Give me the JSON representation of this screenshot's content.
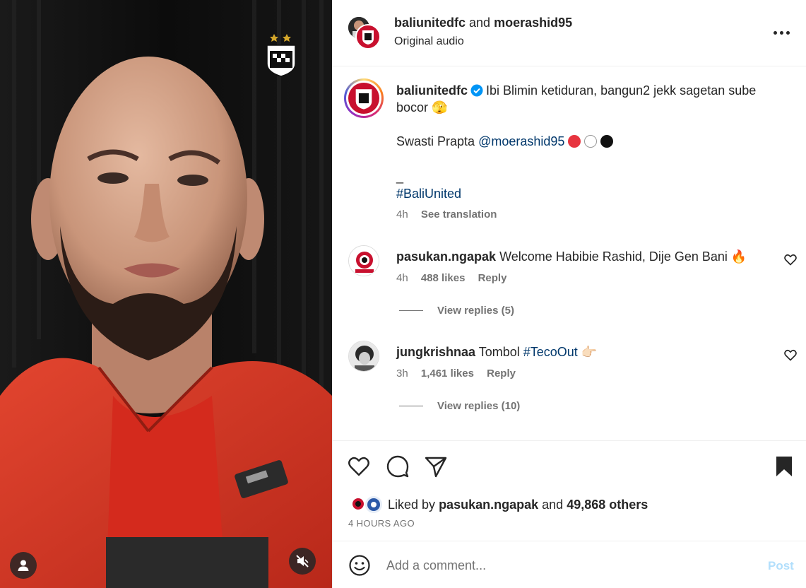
{
  "header": {
    "user1": "baliunitedfc",
    "and": "and",
    "user2": "moerashid95",
    "audio": "Original audio"
  },
  "caption": {
    "username": "baliunitedfc",
    "line1": "Ibi Blimin ketiduran, bangun2 jekk sagetan sube bocor",
    "line1_emoji": "🫣",
    "line2_prefix": "Swasti Prapta",
    "line2_mention": "@moerashid95",
    "dash": "_",
    "hashtag": "#BaliUnited",
    "time": "4h",
    "see_translation": "See translation"
  },
  "comments": [
    {
      "username": "pasukan.ngapak",
      "text": "Welcome Habibie Rashid, Dije Gen Bani",
      "emoji": "🔥",
      "time": "4h",
      "likes": "488 likes",
      "reply": "Reply",
      "view_replies": "View replies (5)"
    },
    {
      "username": "jungkrishnaa",
      "text_prefix": "Tombol",
      "hashtag": "#TecoOut",
      "emoji": "👉🏻",
      "time": "3h",
      "likes": "1,461 likes",
      "reply": "Reply",
      "view_replies": "View replies (10)"
    }
  ],
  "liked_by": {
    "prefix": "Liked by",
    "user": "pasukan.ngapak",
    "middle": "and",
    "others": "49,868 others"
  },
  "time_ago": "4 HOURS AGO",
  "add_comment": {
    "placeholder": "Add a comment...",
    "post": "Post"
  },
  "colors": {
    "brand_red": "#c8102e",
    "link": "#00376b",
    "muted": "#737373",
    "post_disabled": "#b2dffc"
  },
  "icons": [
    "heart-icon",
    "comment-icon",
    "share-icon",
    "bookmark-icon",
    "emoji-icon",
    "more-icon",
    "mute-icon",
    "tagged-user-icon",
    "verified-icon"
  ]
}
